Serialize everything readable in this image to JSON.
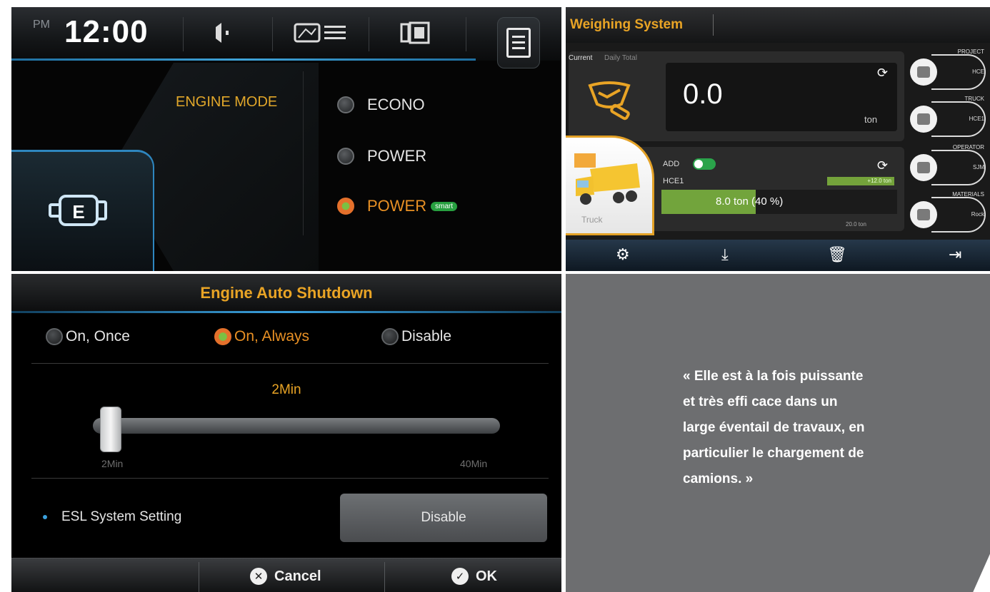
{
  "engine_mode_screen": {
    "ampm": "PM",
    "clock": "12:00",
    "mode_label": "ENGINE MODE",
    "options": [
      {
        "label": "ECONO",
        "selected": false
      },
      {
        "label": "POWER",
        "selected": false
      },
      {
        "label": "POWER",
        "badge": "smart",
        "selected": true
      }
    ],
    "accent_color": "#e89024"
  },
  "weighing_screen": {
    "title": "Weighing System",
    "tabs": [
      "Current",
      "Daily Total"
    ],
    "current_value": "0.0",
    "current_unit": "ton",
    "add_label": "ADD",
    "truck_id": "HCE1",
    "load_text": "8.0 ton (40 %)",
    "load_fraction": 0.4,
    "target_tag": "+12.0 ton",
    "max_label": "20.0 ton",
    "truck_tile_label": "Truck",
    "side_items": [
      {
        "caption": "PROJECT",
        "value": "HCE",
        "icon": "folder-icon"
      },
      {
        "caption": "TRUCK",
        "value": "HCE1",
        "icon": "truck-icon"
      },
      {
        "caption": "OPERATOR",
        "value": "SJM",
        "icon": "user-icon"
      },
      {
        "caption": "MATERIALS",
        "value": "Rock",
        "icon": "rock-icon"
      }
    ],
    "footer_icons": [
      "gear-icon",
      "download-icon",
      "trash-icon",
      "exit-icon"
    ]
  },
  "shutdown_screen": {
    "title": "Engine Auto Shutdown",
    "options": [
      {
        "label": "On, Once",
        "selected": false
      },
      {
        "label": "On, Always",
        "selected": true
      },
      {
        "label": "Disable",
        "selected": false
      }
    ],
    "slider_value": "2Min",
    "slider_min": "2Min",
    "slider_max": "40Min",
    "esl_label": "ESL System Setting",
    "esl_button": "Disable",
    "cancel_label": "Cancel",
    "ok_label": "OK"
  },
  "quote": {
    "lines": [
      "« Elle est à la fois puissante",
      "et très effi cace dans un",
      "large éventail de travaux, en",
      "particulier le chargement de",
      "camions. »"
    ]
  }
}
